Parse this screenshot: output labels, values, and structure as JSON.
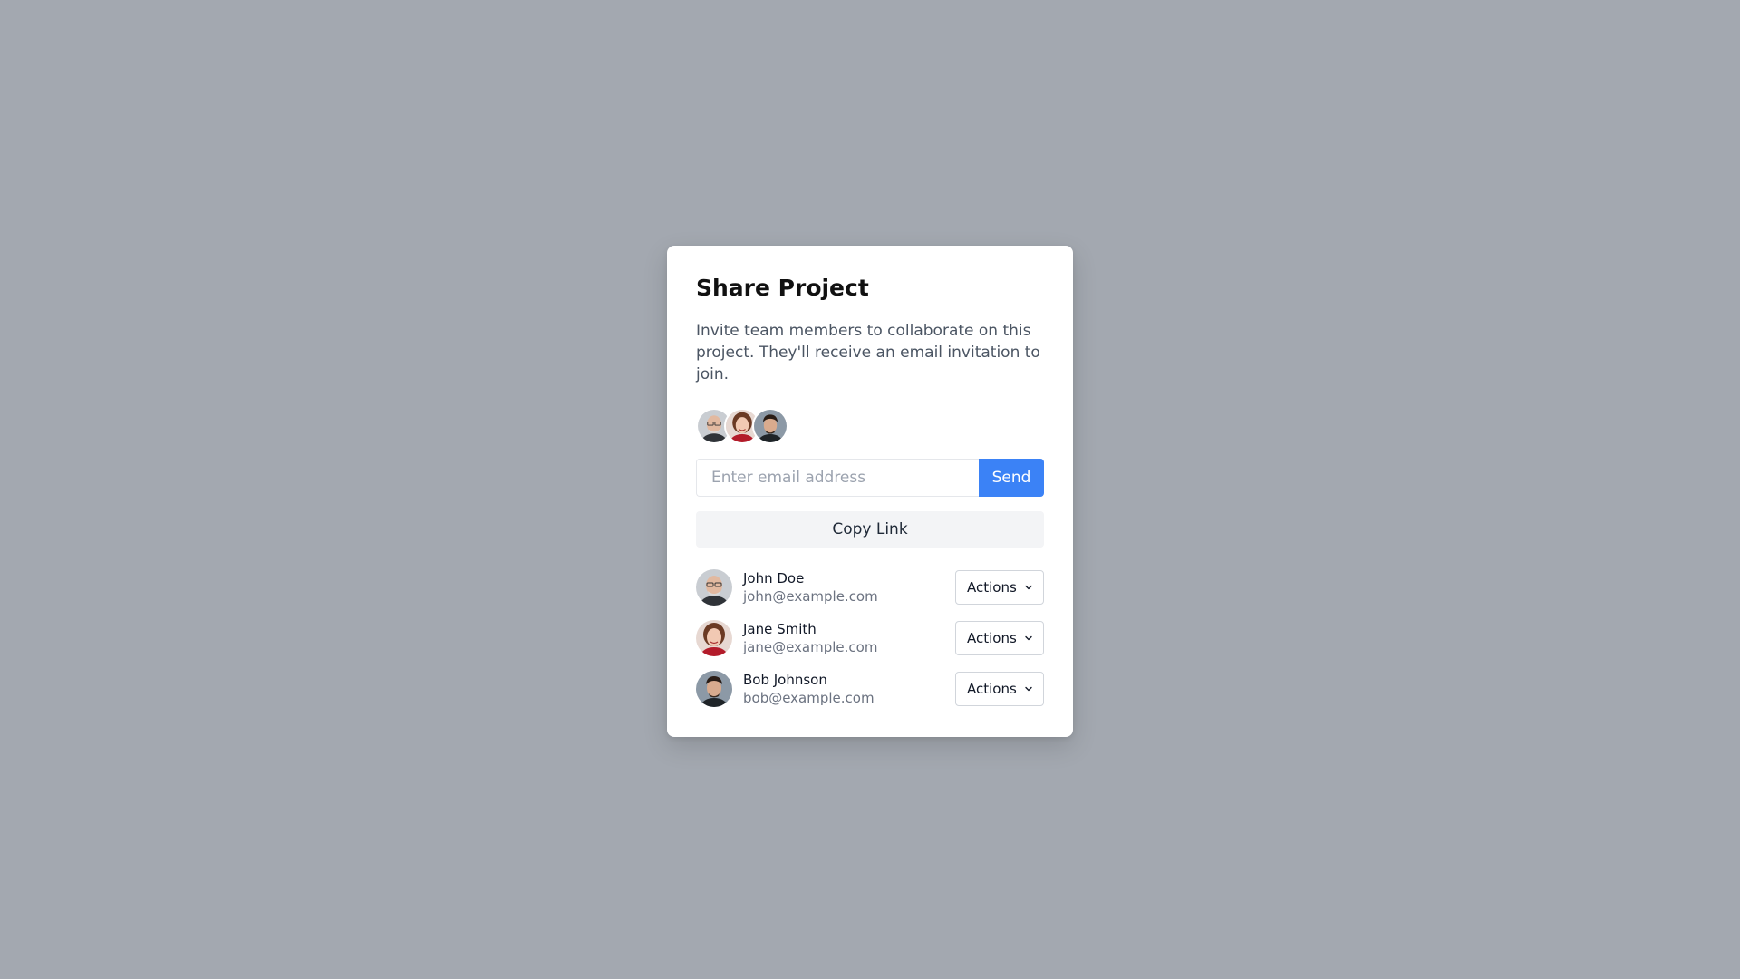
{
  "dialog": {
    "title": "Share Project",
    "description": "Invite team members to collaborate on this project. They'll receive an email invitation to join."
  },
  "invite": {
    "placeholder": "Enter email address",
    "value": "",
    "send_label": "Send"
  },
  "copy_link_label": "Copy Link",
  "colors": {
    "overlay": "#a3a8b0",
    "accent": "#3b82f6",
    "muted_button": "#f3f4f6"
  },
  "members": [
    {
      "name": "John Doe",
      "email": "john@example.com",
      "action_label": "Actions",
      "icon": "chevron-down-icon"
    },
    {
      "name": "Jane Smith",
      "email": "jane@example.com",
      "action_label": "Actions",
      "icon": "chevron-down-icon"
    },
    {
      "name": "Bob Johnson",
      "email": "bob@example.com",
      "action_label": "Actions",
      "icon": "chevron-down-icon"
    }
  ]
}
